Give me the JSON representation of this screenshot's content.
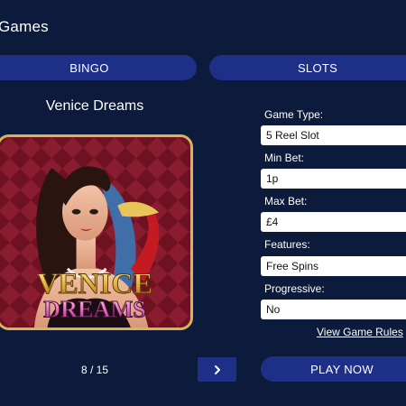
{
  "header": {
    "title": "Games"
  },
  "tabs": [
    {
      "label": "BINGO"
    },
    {
      "label": "SLOTS"
    }
  ],
  "game": {
    "name": "Venice Dreams",
    "logo_text": [
      "VENICE",
      "DREAMS"
    ]
  },
  "details": {
    "game_type_label": "Game Type:",
    "game_type_value": "5 Reel Slot",
    "min_bet_label": "Min Bet:",
    "min_bet_value": "1p",
    "max_bet_label": "Max Bet:",
    "max_bet_value": "£4",
    "features_label": "Features:",
    "features_value": "Free Spins",
    "progressive_label": "Progressive:",
    "progressive_value": "No"
  },
  "links": {
    "view_rules": "View Game Rules"
  },
  "pager": {
    "text": "8 / 15",
    "next_icon": "chevron-right-icon"
  },
  "play_button": {
    "label": "PLAY NOW"
  },
  "colors": {
    "background": "#0c1b3b",
    "button": "#1e2f88",
    "frame_gold": "#d7b45c"
  }
}
